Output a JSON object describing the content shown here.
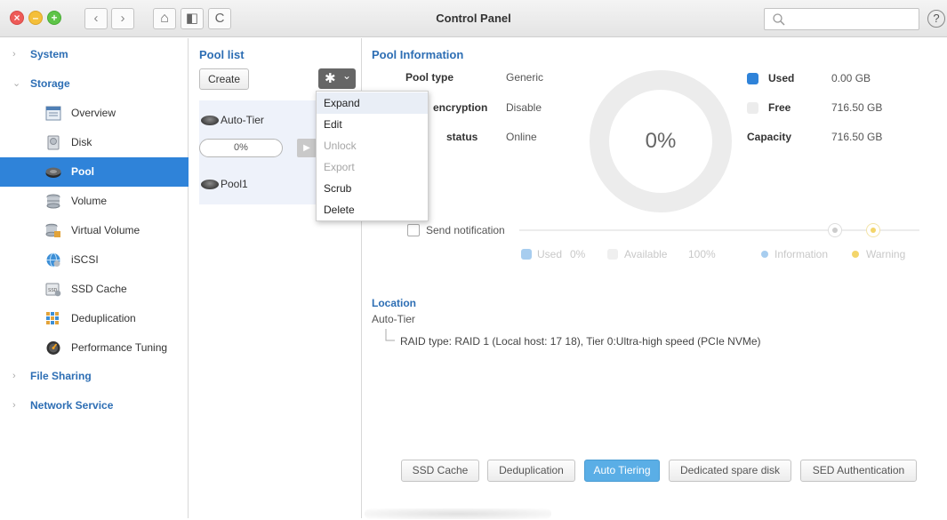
{
  "window": {
    "title": "Control Panel",
    "close_glyph": "×",
    "min_glyph": "–",
    "max_glyph": "+",
    "back_glyph": "‹",
    "forward_glyph": "›",
    "home_glyph": "⌂",
    "split_glyph": "◧",
    "refresh_glyph": "C",
    "help_glyph": "?",
    "search": {
      "placeholder": "",
      "value": ""
    }
  },
  "sidebar": {
    "groups": [
      {
        "label": "System",
        "expanded": false
      },
      {
        "label": "Storage",
        "expanded": true
      },
      {
        "label": "File Sharing",
        "expanded": false
      },
      {
        "label": "Network Service",
        "expanded": false
      }
    ],
    "items": [
      {
        "label": "Overview",
        "icon": "overview-icon"
      },
      {
        "label": "Disk",
        "icon": "disk-icon"
      },
      {
        "label": "Pool",
        "icon": "pool-icon",
        "active": true
      },
      {
        "label": "Volume",
        "icon": "volume-icon"
      },
      {
        "label": "Virtual Volume",
        "icon": "virtual-volume-icon"
      },
      {
        "label": "iSCSI",
        "icon": "iscsi-icon"
      },
      {
        "label": "SSD Cache",
        "icon": "ssd-cache-icon"
      },
      {
        "label": "Deduplication",
        "icon": "deduplication-icon"
      },
      {
        "label": "Performance Tuning",
        "icon": "performance-tuning-icon"
      }
    ],
    "arrow_collapsed": "›",
    "arrow_expanded": "⌄"
  },
  "pool_list": {
    "heading": "Pool list",
    "create_label": "Create",
    "gear_glyph": "✱",
    "gear_caret": "⌄",
    "pools": [
      {
        "name": "Auto-Tier",
        "progress": "0%"
      },
      {
        "name": "Pool1"
      }
    ],
    "play_glyph": "▶"
  },
  "menu": {
    "items": [
      {
        "label": "Expand",
        "state": "hover"
      },
      {
        "label": "Edit",
        "state": "normal"
      },
      {
        "label": "Unlock",
        "state": "disabled"
      },
      {
        "label": "Export",
        "state": "disabled"
      },
      {
        "label": "Scrub",
        "state": "normal"
      },
      {
        "label": "Delete",
        "state": "normal"
      }
    ]
  },
  "pool_info": {
    "heading": "Pool Information",
    "rows": [
      {
        "label": "Pool type",
        "value": "Generic"
      },
      {
        "label": "encryption",
        "value": "Disable"
      },
      {
        "label": "status",
        "value": "Online"
      }
    ],
    "donut_label": "0%",
    "used_label": "Used",
    "used_value": "0.00 GB",
    "free_label": "Free",
    "free_value": "716.50 GB",
    "capacity_label": "Capacity",
    "capacity_value": "716.50 GB",
    "used_color": "#2f83d9",
    "free_color": "#ececec"
  },
  "notification": {
    "label": "Send notification",
    "legend_used": "Used",
    "legend_used_pct": "0%",
    "legend_available": "Available",
    "legend_available_pct": "100%",
    "legend_information": "Information",
    "legend_warning": "Warning"
  },
  "location": {
    "heading": "Location",
    "pool_name": "Auto-Tier",
    "raid_detail": "RAID type: RAID 1 (Local host: 17 18), Tier 0:Ultra-high speed (PCIe NVMe)"
  },
  "bottom_tabs": [
    {
      "label": "SSD Cache",
      "active": false
    },
    {
      "label": "Deduplication",
      "active": false
    },
    {
      "label": "Auto Tiering",
      "active": true
    },
    {
      "label": "Dedicated spare disk",
      "active": false
    },
    {
      "label": "SED Authentication",
      "active": false
    }
  ]
}
